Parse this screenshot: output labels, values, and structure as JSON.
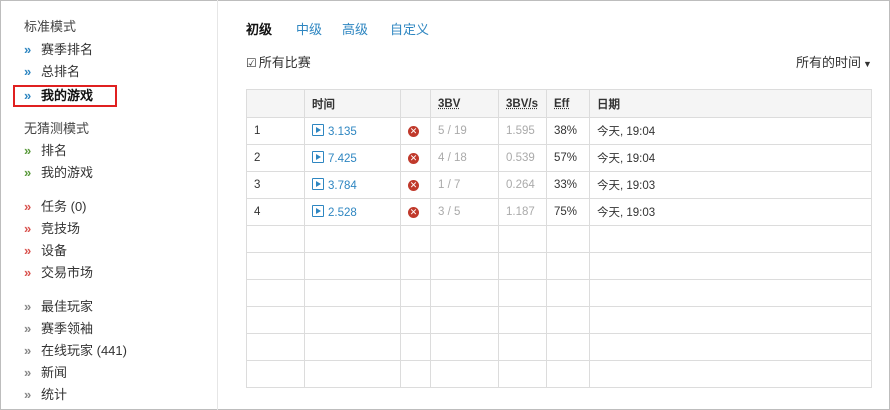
{
  "sidebar": {
    "standard_heading": "标准模式",
    "standard_items": [
      {
        "label": "赛季排名"
      },
      {
        "label": "总排名"
      },
      {
        "label": "我的游戏"
      }
    ],
    "nonguess_heading": "无猜测模式",
    "nonguess_items": [
      {
        "label": "排名"
      },
      {
        "label": "我的游戏"
      }
    ],
    "misc_items": [
      {
        "label": "任务 (0)"
      },
      {
        "label": "竞技场"
      },
      {
        "label": "设备"
      },
      {
        "label": "交易市场"
      }
    ],
    "community_items": [
      {
        "label": "最佳玩家"
      },
      {
        "label": "赛季领袖"
      },
      {
        "label": "在线玩家 (441)"
      },
      {
        "label": "新闻"
      },
      {
        "label": "统计"
      }
    ]
  },
  "tabs": [
    {
      "label": "初级",
      "active": true
    },
    {
      "label": "中级",
      "active": false
    },
    {
      "label": "高级",
      "active": false
    },
    {
      "label": "自定义",
      "active": false
    }
  ],
  "filter": {
    "all_games_label": "所有比赛",
    "all_games_checked": true,
    "time_filter": "所有的时间"
  },
  "table": {
    "headers": [
      "",
      "时间",
      "",
      "3BV",
      "3BV/s",
      "Eff",
      "日期"
    ],
    "rows": [
      {
        "num": "1",
        "time": "3.135",
        "bv": "5 / 19",
        "bvs": "1.595",
        "eff": "38%",
        "date": "今天, 19:04"
      },
      {
        "num": "2",
        "time": "7.425",
        "bv": "4 / 18",
        "bvs": "0.539",
        "eff": "57%",
        "date": "今天, 19:04"
      },
      {
        "num": "3",
        "time": "3.784",
        "bv": "1 / 7",
        "bvs": "0.264",
        "eff": "33%",
        "date": "今天, 19:03"
      },
      {
        "num": "4",
        "time": "2.528",
        "bv": "3 / 5",
        "bvs": "1.187",
        "eff": "75%",
        "date": "今天, 19:03"
      }
    ]
  },
  "colors": {
    "link": "#2e86c1",
    "selection_outline": "#e02020",
    "fail_icon": "#c0392b"
  }
}
